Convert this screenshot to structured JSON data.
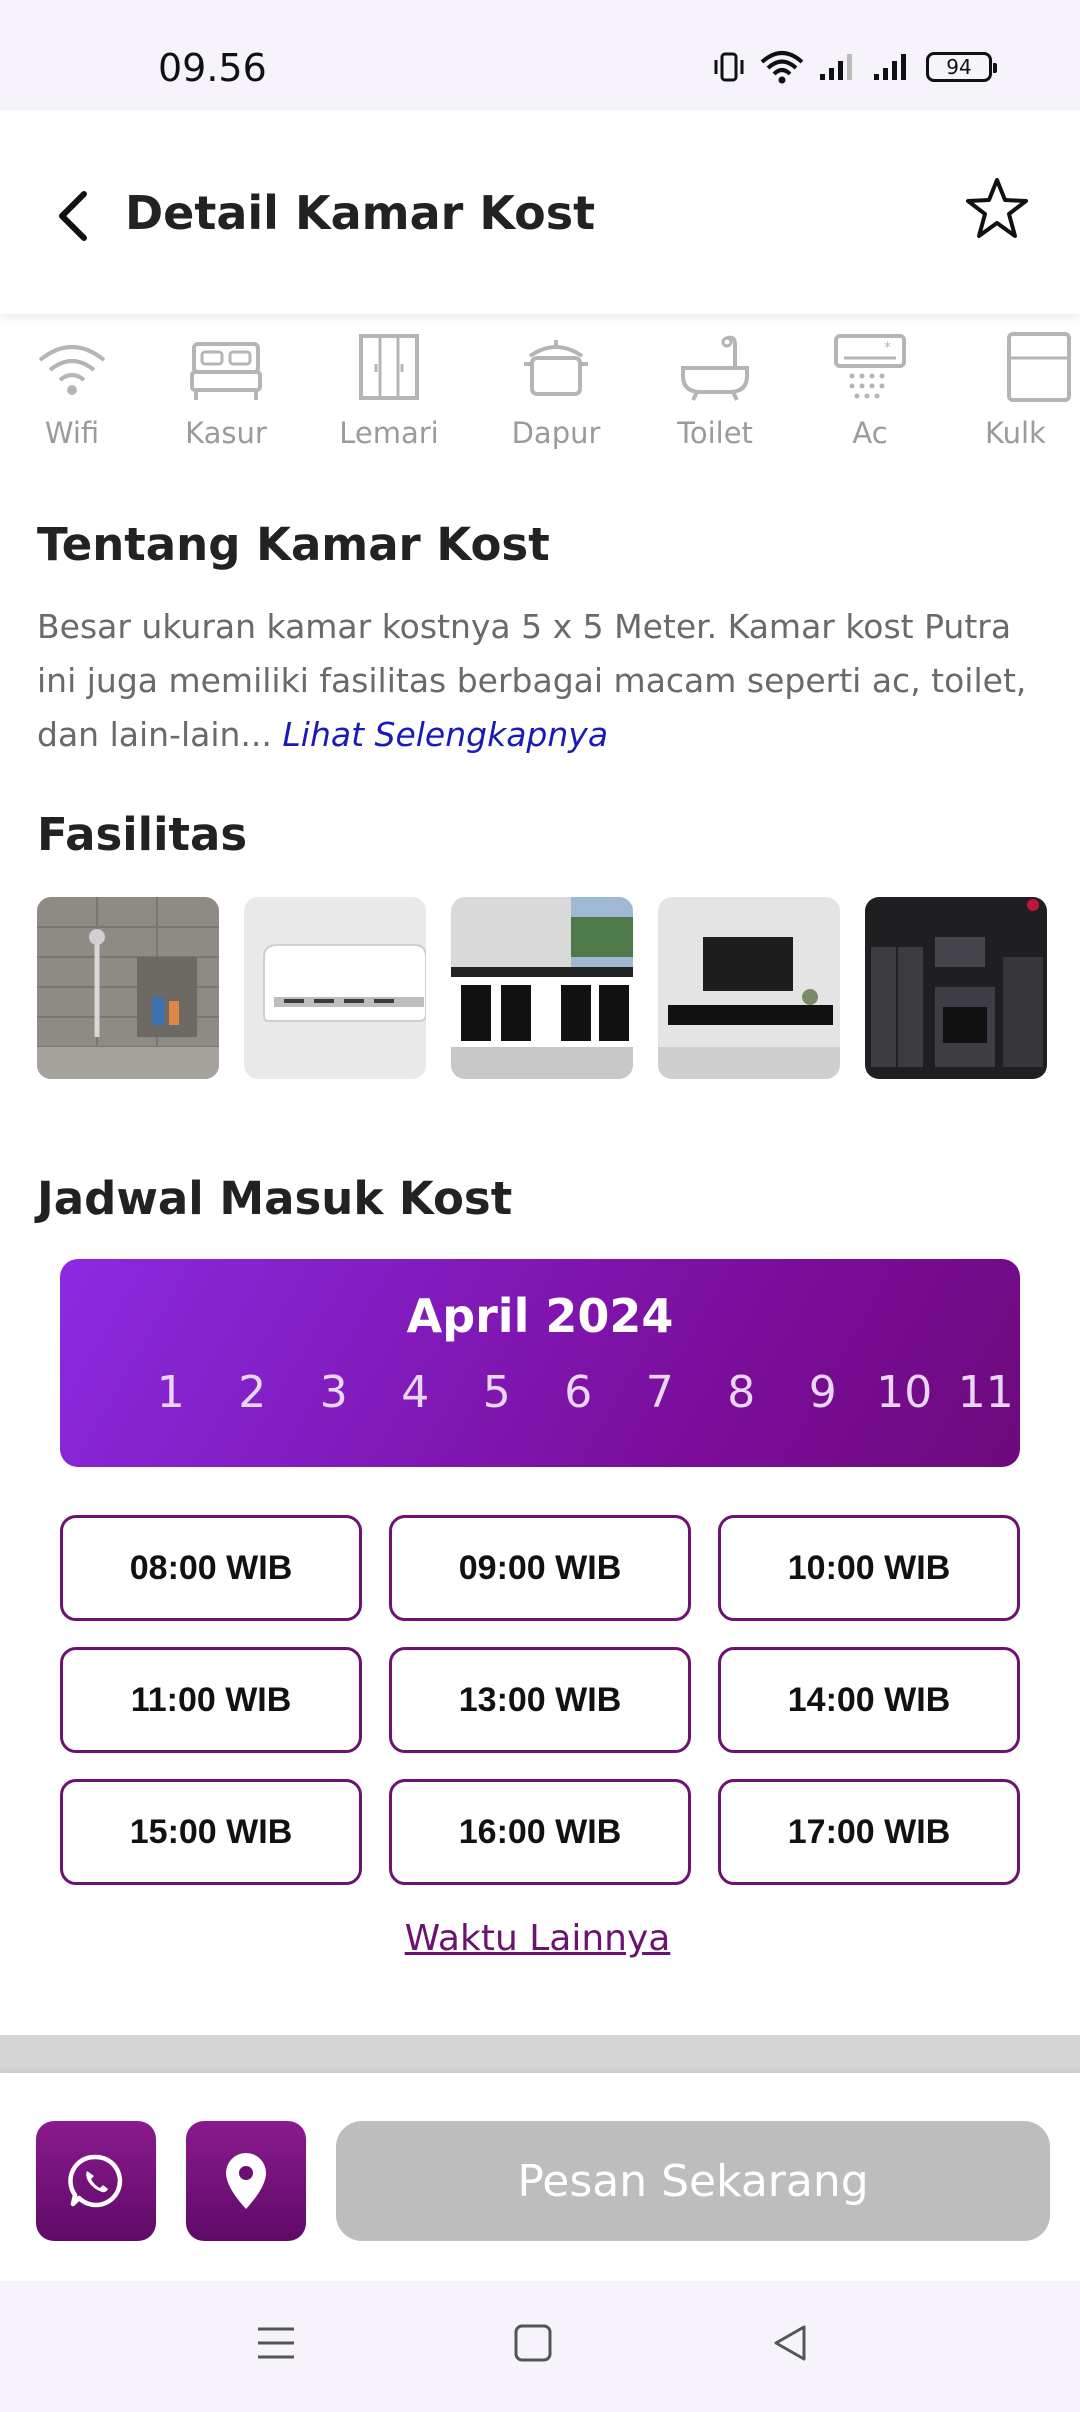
{
  "status_bar": {
    "time": "09.56",
    "battery": "94"
  },
  "header": {
    "title": "Detail Kamar Kost"
  },
  "amenities": [
    {
      "label": "Wifi",
      "icon": "wifi-icon"
    },
    {
      "label": "Kasur",
      "icon": "bed-icon"
    },
    {
      "label": "Lemari",
      "icon": "wardrobe-icon"
    },
    {
      "label": "Dapur",
      "icon": "cooking-pot-icon"
    },
    {
      "label": "Toilet",
      "icon": "bathtub-icon"
    },
    {
      "label": "Ac",
      "icon": "air-conditioner-icon"
    },
    {
      "label": "Kulk",
      "icon": "refrigerator-icon"
    }
  ],
  "about": {
    "title": "Tentang Kamar Kost",
    "text": "Besar ukuran kamar kostnya 5 x 5 Meter. Kamar kost Putra ini juga memiliki fasilitas berbagai macam seperti ac, toilet, dan lain-lain... ",
    "see_more": "Lihat Selengkapnya"
  },
  "facilities": {
    "title": "Fasilitas",
    "images": [
      "bathroom-shower-photo",
      "air-conditioner-photo",
      "kitchen-photo",
      "tv-cabinet-photo",
      "kitchen-appliances-photo"
    ]
  },
  "schedule": {
    "title": "Jadwal Masuk Kost",
    "month": "April 2024",
    "days": [
      "1",
      "2",
      "3",
      "4",
      "5",
      "6",
      "7",
      "8",
      "9",
      "10",
      "11"
    ],
    "times": [
      "08:00 WIB",
      "09:00 WIB",
      "10:00 WIB",
      "11:00 WIB",
      "13:00 WIB",
      "14:00 WIB",
      "15:00 WIB",
      "16:00 WIB",
      "17:00 WIB"
    ],
    "other_times": "Waktu Lainnya"
  },
  "bottom_bar": {
    "order_label": "Pesan Sekarang"
  },
  "colors": {
    "accent": "#6c1372",
    "gradient_start": "#8a2be2",
    "gradient_end": "#6e0a7c",
    "disabled_button": "#bdbdbd"
  }
}
